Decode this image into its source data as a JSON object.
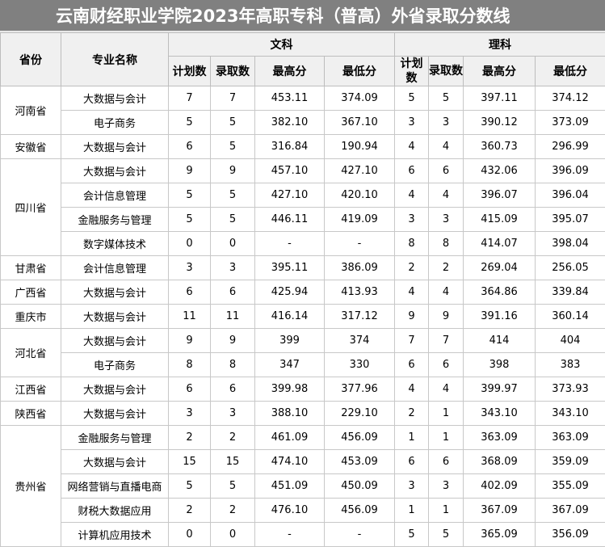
{
  "title": "云南财经职业学院2023年高职专科（普高）外省录取分数线",
  "headers": {
    "province": "省份",
    "major": "专业名称",
    "liberal_arts": "文科",
    "science": "理科",
    "plan": "计划数",
    "admitted": "录取数",
    "max_score": "最高分",
    "min_score": "最低分"
  },
  "rows": [
    {
      "province": "河南省",
      "span": 2,
      "major": "大数据与会计",
      "w_plan": "7",
      "w_adm": "7",
      "w_max": "453.11",
      "w_min": "374.09",
      "s_plan": "5",
      "s_adm": "5",
      "s_max": "397.11",
      "s_min": "374.12"
    },
    {
      "major": "电子商务",
      "w_plan": "5",
      "w_adm": "5",
      "w_max": "382.10",
      "w_min": "367.10",
      "s_plan": "3",
      "s_adm": "3",
      "s_max": "390.12",
      "s_min": "373.09"
    },
    {
      "province": "安徽省",
      "span": 1,
      "major": "大数据与会计",
      "w_plan": "6",
      "w_adm": "5",
      "w_max": "316.84",
      "w_min": "190.94",
      "s_plan": "4",
      "s_adm": "4",
      "s_max": "360.73",
      "s_min": "296.99"
    },
    {
      "province": "四川省",
      "span": 4,
      "major": "大数据与会计",
      "w_plan": "9",
      "w_adm": "9",
      "w_max": "457.10",
      "w_min": "427.10",
      "s_plan": "6",
      "s_adm": "6",
      "s_max": "432.06",
      "s_min": "396.09"
    },
    {
      "major": "会计信息管理",
      "w_plan": "5",
      "w_adm": "5",
      "w_max": "427.10",
      "w_min": "420.10",
      "s_plan": "4",
      "s_adm": "4",
      "s_max": "396.07",
      "s_min": "396.04"
    },
    {
      "major": "金融服务与管理",
      "w_plan": "5",
      "w_adm": "5",
      "w_max": "446.11",
      "w_min": "419.09",
      "s_plan": "3",
      "s_adm": "3",
      "s_max": "415.09",
      "s_min": "395.07"
    },
    {
      "major": "数字媒体技术",
      "w_plan": "0",
      "w_adm": "0",
      "w_max": "-",
      "w_min": "-",
      "s_plan": "8",
      "s_adm": "8",
      "s_max": "414.07",
      "s_min": "398.04"
    },
    {
      "province": "甘肃省",
      "span": 1,
      "major": "会计信息管理",
      "w_plan": "3",
      "w_adm": "3",
      "w_max": "395.11",
      "w_min": "386.09",
      "s_plan": "2",
      "s_adm": "2",
      "s_max": "269.04",
      "s_min": "256.05"
    },
    {
      "province": "广西省",
      "span": 1,
      "major": "大数据与会计",
      "w_plan": "6",
      "w_adm": "6",
      "w_max": "425.94",
      "w_min": "413.93",
      "s_plan": "4",
      "s_adm": "4",
      "s_max": "364.86",
      "s_min": "339.84"
    },
    {
      "province": "重庆市",
      "span": 1,
      "major": "大数据与会计",
      "w_plan": "11",
      "w_adm": "11",
      "w_max": "416.14",
      "w_min": "317.12",
      "s_plan": "9",
      "s_adm": "9",
      "s_max": "391.16",
      "s_min": "360.14"
    },
    {
      "province": "河北省",
      "span": 2,
      "major": "大数据与会计",
      "w_plan": "9",
      "w_adm": "9",
      "w_max": "399",
      "w_min": "374",
      "s_plan": "7",
      "s_adm": "7",
      "s_max": "414",
      "s_min": "404"
    },
    {
      "major": "电子商务",
      "w_plan": "8",
      "w_adm": "8",
      "w_max": "347",
      "w_min": "330",
      "s_plan": "6",
      "s_adm": "6",
      "s_max": "398",
      "s_min": "383"
    },
    {
      "province": "江西省",
      "span": 1,
      "major": "大数据与会计",
      "w_plan": "6",
      "w_adm": "6",
      "w_max": "399.98",
      "w_min": "377.96",
      "s_plan": "4",
      "s_adm": "4",
      "s_max": "399.97",
      "s_min": "373.93"
    },
    {
      "province": "陕西省",
      "span": 1,
      "major": "大数据与会计",
      "w_plan": "3",
      "w_adm": "3",
      "w_max": "388.10",
      "w_min": "229.10",
      "s_plan": "2",
      "s_adm": "1",
      "s_max": "343.10",
      "s_min": "343.10"
    },
    {
      "province": "贵州省",
      "span": 5,
      "major": "金融服务与管理",
      "w_plan": "2",
      "w_adm": "2",
      "w_max": "461.09",
      "w_min": "456.09",
      "s_plan": "1",
      "s_adm": "1",
      "s_max": "363.09",
      "s_min": "363.09"
    },
    {
      "major": "大数据与会计",
      "w_plan": "15",
      "w_adm": "15",
      "w_max": "474.10",
      "w_min": "453.09",
      "s_plan": "6",
      "s_adm": "6",
      "s_max": "368.09",
      "s_min": "359.09"
    },
    {
      "major": "网络营销与直播电商",
      "w_plan": "5",
      "w_adm": "5",
      "w_max": "451.09",
      "w_min": "450.09",
      "s_plan": "3",
      "s_adm": "3",
      "s_max": "402.09",
      "s_min": "355.09"
    },
    {
      "major": "财税大数据应用",
      "w_plan": "2",
      "w_adm": "2",
      "w_max": "476.10",
      "w_min": "456.09",
      "s_plan": "1",
      "s_adm": "1",
      "s_max": "367.09",
      "s_min": "367.09"
    },
    {
      "major": "计算机应用技术",
      "w_plan": "0",
      "w_adm": "0",
      "w_max": "-",
      "w_min": "-",
      "s_plan": "5",
      "s_adm": "5",
      "s_max": "365.09",
      "s_min": "356.09"
    }
  ]
}
